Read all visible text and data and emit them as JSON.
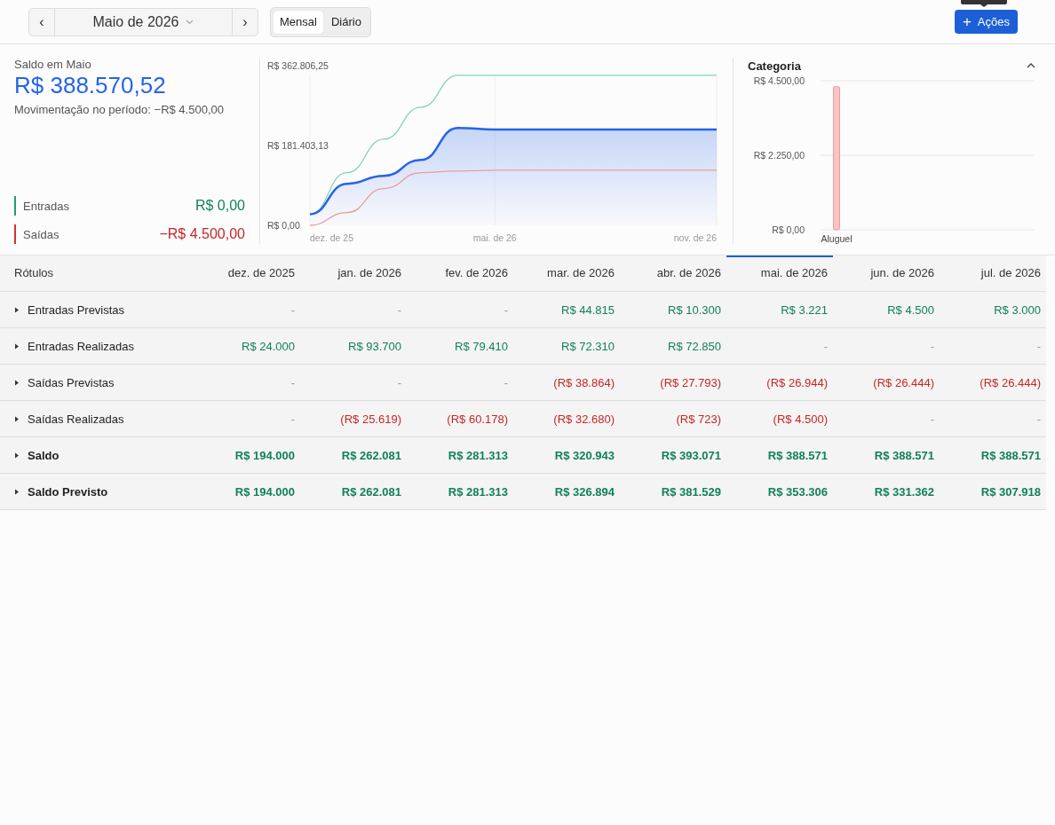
{
  "toolbar": {
    "prev_label": "‹",
    "period": "Maio de 2026",
    "next_label": "›",
    "views": [
      {
        "label": "Mensal",
        "selected": true
      },
      {
        "label": "Diário",
        "selected": false
      }
    ],
    "action": {
      "icon": "+",
      "label": "Ações"
    }
  },
  "summary": {
    "title": "Saldo em Maio",
    "balance": "R$ 388.570,52",
    "movement": "Movimentação no período: −R$ 4.500,00",
    "totals": [
      {
        "label": "Entradas",
        "value": "R$ 0,00",
        "color": "#1f9d74"
      },
      {
        "label": "Saídas",
        "value": "−R$ 4.500,00",
        "color": "#d92f2f"
      }
    ]
  },
  "balance_chart": {
    "y_labels": [
      "R$ 362.806,25",
      "R$ 181.403,13",
      "R$ 0,00"
    ],
    "x_labels": [
      "dez. de 25",
      "mai. de 26",
      "nov. de 26"
    ]
  },
  "category_chart": {
    "title": "Categoria",
    "expanded": true,
    "y_labels": [
      "R$ 4.500,00",
      "R$ 2.250,00",
      "R$ 0,00"
    ],
    "bars": [
      {
        "label": "Aluguel",
        "level": 0.96
      }
    ]
  },
  "table": {
    "label_header": "Rótulos",
    "columns": [
      {
        "label": "dez. de 2025",
        "selected": false
      },
      {
        "label": "jan. de 2026",
        "selected": false
      },
      {
        "label": "fev. de 2026",
        "selected": false
      },
      {
        "label": "mar. de 2026",
        "selected": false
      },
      {
        "label": "abr. de 2026",
        "selected": false
      },
      {
        "label": "mai. de 2026",
        "selected": true
      },
      {
        "label": "jun. de 2026",
        "selected": false
      },
      {
        "label": "jul. de 2026",
        "selected": false
      }
    ],
    "rows": [
      {
        "label": "Entradas Previstas",
        "expanded": false,
        "bold": false,
        "cells": [
          {
            "kind": "empty",
            "text": "-"
          },
          {
            "kind": "empty",
            "text": "-"
          },
          {
            "kind": "empty",
            "text": "-"
          },
          {
            "kind": "positive",
            "text": "R$ 44.815"
          },
          {
            "kind": "positive",
            "text": "R$ 10.300"
          },
          {
            "kind": "positive",
            "text": "R$ 3.221"
          },
          {
            "kind": "positive",
            "text": "R$ 4.500"
          },
          {
            "kind": "positive",
            "text": "R$ 3.000"
          }
        ]
      },
      {
        "label": "Entradas Realizadas",
        "expanded": false,
        "bold": false,
        "cells": [
          {
            "kind": "positive",
            "text": "R$ 24.000"
          },
          {
            "kind": "positive",
            "text": "R$ 93.700"
          },
          {
            "kind": "positive",
            "text": "R$ 79.410"
          },
          {
            "kind": "positive",
            "text": "R$ 72.310"
          },
          {
            "kind": "positive",
            "text": "R$ 72.850"
          },
          {
            "kind": "empty",
            "text": "-"
          },
          {
            "kind": "empty",
            "text": "-"
          },
          {
            "kind": "empty",
            "text": "-"
          }
        ]
      },
      {
        "label": "Saídas Previstas",
        "expanded": false,
        "bold": false,
        "cells": [
          {
            "kind": "empty",
            "text": "-"
          },
          {
            "kind": "empty",
            "text": "-"
          },
          {
            "kind": "empty",
            "text": "-"
          },
          {
            "kind": "negative",
            "text": "(R$ 38.864)"
          },
          {
            "kind": "negative",
            "text": "(R$ 27.793)"
          },
          {
            "kind": "negative",
            "text": "(R$ 26.944)"
          },
          {
            "kind": "negative",
            "text": "(R$ 26.444)"
          },
          {
            "kind": "negative",
            "text": "(R$ 26.444)"
          }
        ]
      },
      {
        "label": "Saídas Realizadas",
        "expanded": false,
        "bold": false,
        "cells": [
          {
            "kind": "empty",
            "text": "-"
          },
          {
            "kind": "negative",
            "text": "(R$ 25.619)"
          },
          {
            "kind": "negative",
            "text": "(R$ 60.178)"
          },
          {
            "kind": "negative",
            "text": "(R$ 32.680)"
          },
          {
            "kind": "negative",
            "text": "(R$ 723)"
          },
          {
            "kind": "negative",
            "text": "(R$ 4.500)"
          },
          {
            "kind": "empty",
            "text": "-"
          },
          {
            "kind": "empty",
            "text": "-"
          }
        ]
      },
      {
        "label": "Saldo",
        "expanded": false,
        "bold": true,
        "cells": [
          {
            "kind": "positive",
            "text": "R$ 194.000"
          },
          {
            "kind": "positive",
            "text": "R$ 262.081"
          },
          {
            "kind": "positive",
            "text": "R$ 281.313"
          },
          {
            "kind": "positive",
            "text": "R$ 320.943"
          },
          {
            "kind": "positive",
            "text": "R$ 393.071"
          },
          {
            "kind": "positive",
            "text": "R$ 388.571"
          },
          {
            "kind": "positive",
            "text": "R$ 388.571"
          },
          {
            "kind": "positive",
            "text": "R$ 388.571"
          }
        ]
      },
      {
        "label": "Saldo Previsto",
        "expanded": false,
        "bold": true,
        "cells": [
          {
            "kind": "positive",
            "text": "R$ 194.000"
          },
          {
            "kind": "positive",
            "text": "R$ 262.081"
          },
          {
            "kind": "positive",
            "text": "R$ 281.313"
          },
          {
            "kind": "positive",
            "text": "R$ 326.894"
          },
          {
            "kind": "positive",
            "text": "R$ 381.529"
          },
          {
            "kind": "positive",
            "text": "R$ 353.306"
          },
          {
            "kind": "positive",
            "text": "R$ 331.362"
          },
          {
            "kind": "positive",
            "text": "R$ 307.918"
          }
        ]
      }
    ]
  }
}
